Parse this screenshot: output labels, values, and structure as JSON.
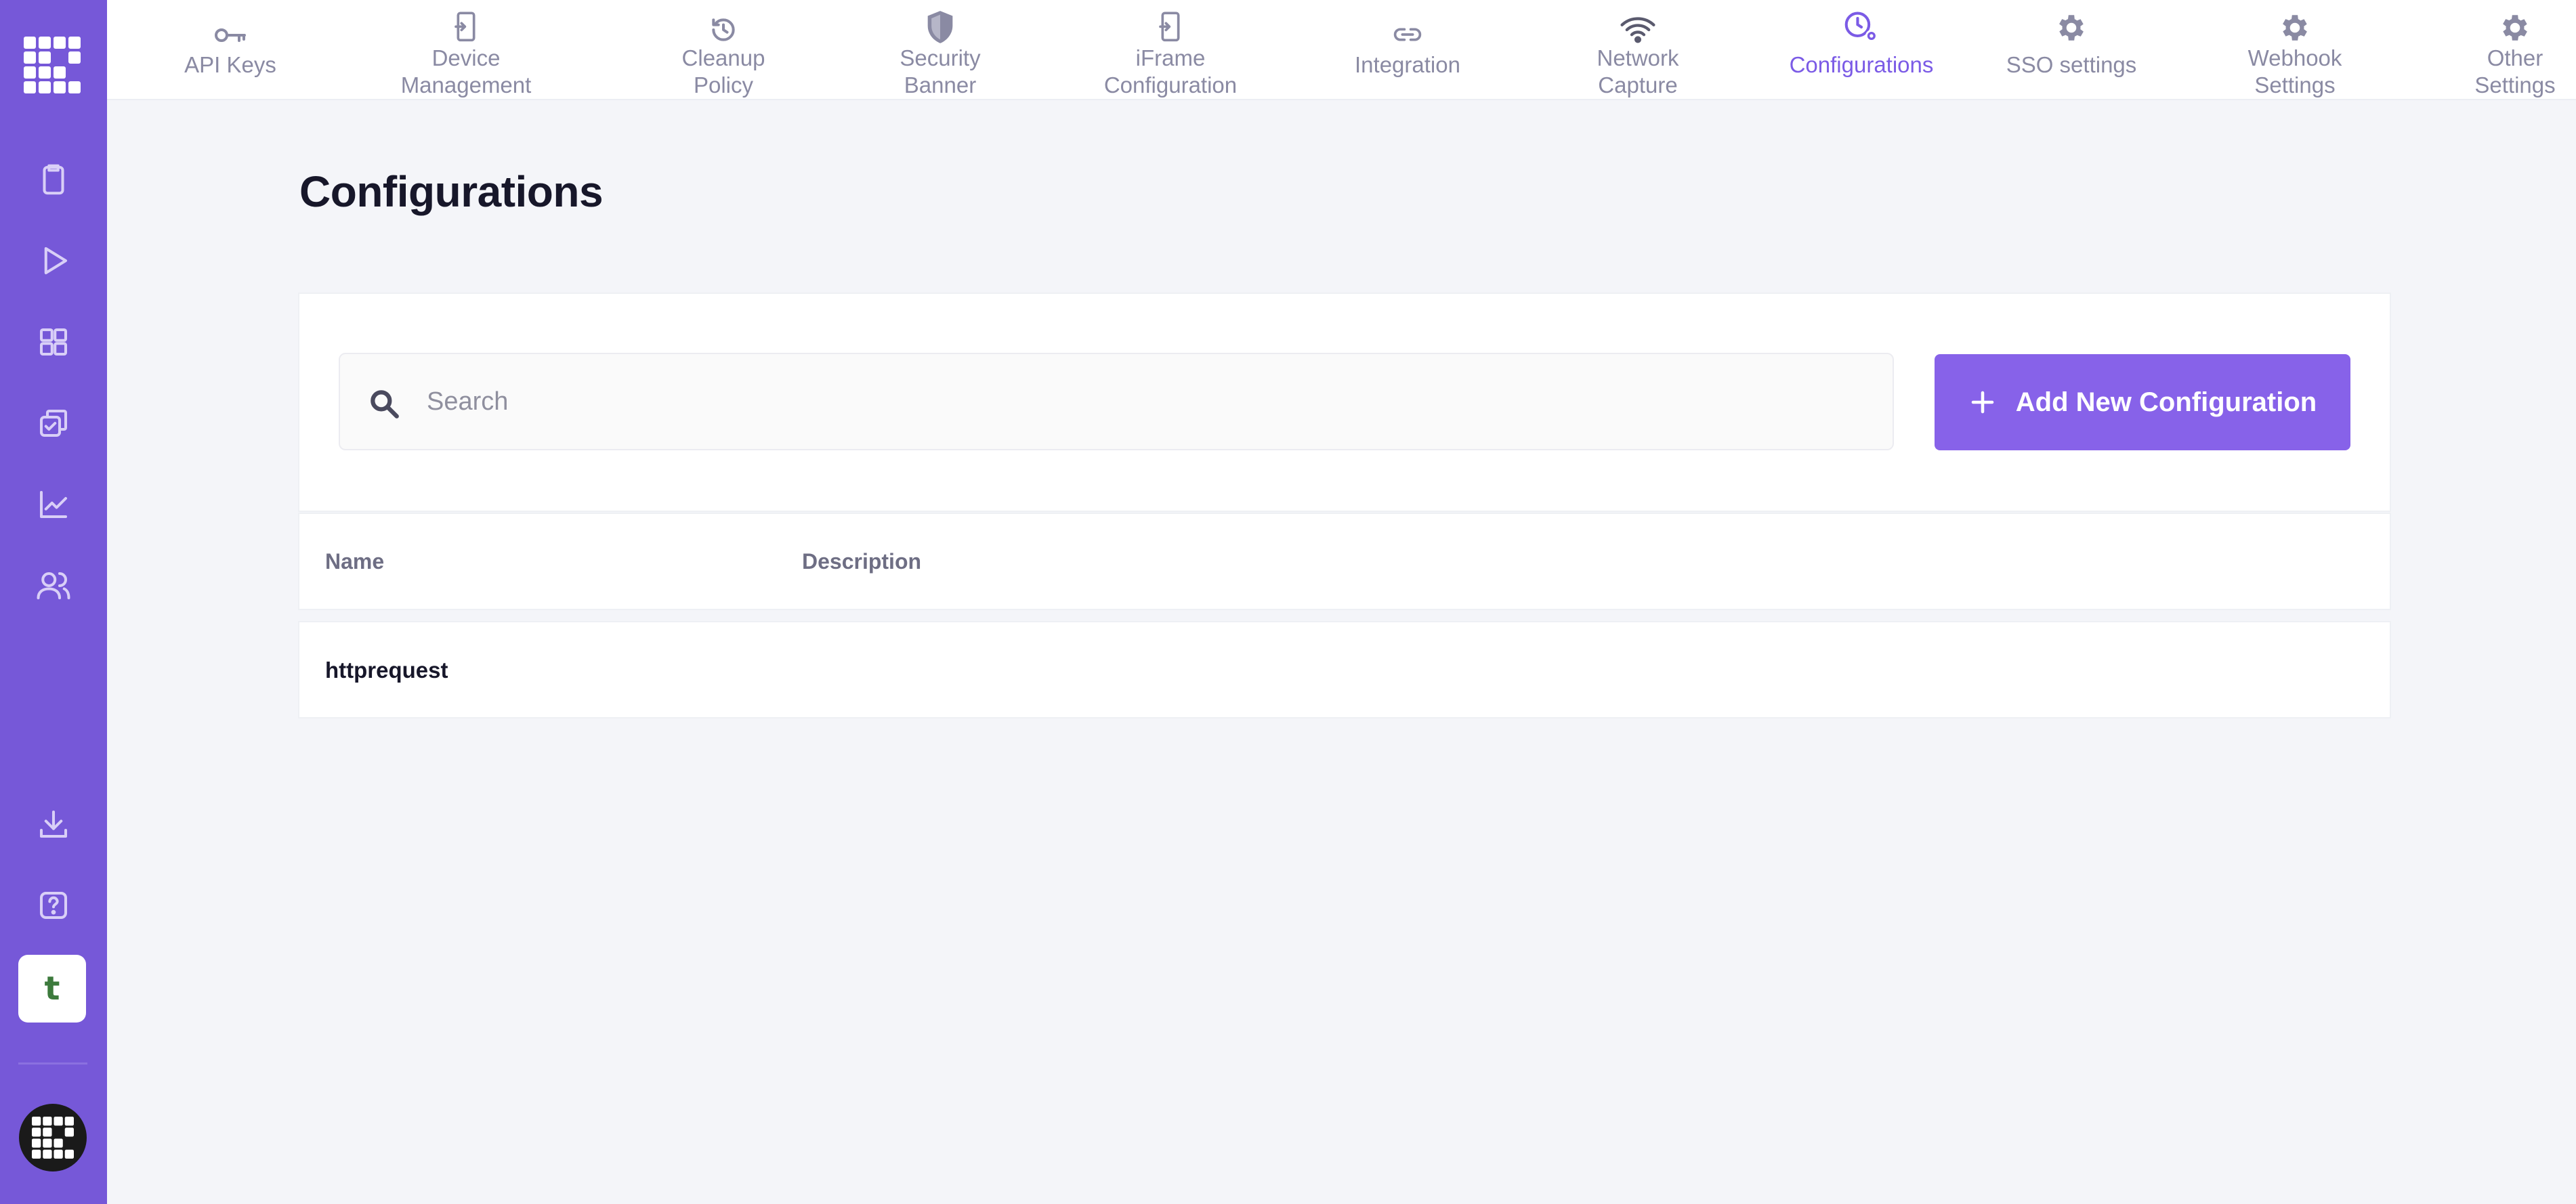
{
  "colors": {
    "sidebar": "#7658d8",
    "accent": "#7b5be6",
    "button": "#8762e9",
    "tab_inactive": "#8a8aa3",
    "background": "#f4f5f9"
  },
  "sidebar": {
    "items": [
      {
        "icon": "clipboard-icon"
      },
      {
        "icon": "play-icon"
      },
      {
        "icon": "grid-icon"
      },
      {
        "icon": "checklist-icon"
      },
      {
        "icon": "chart-icon"
      },
      {
        "icon": "users-icon"
      },
      {
        "icon": "download-icon"
      },
      {
        "icon": "help-icon"
      }
    ],
    "avatar_letter": "t"
  },
  "tabs": [
    {
      "label": "API Keys",
      "icon": "key-icon"
    },
    {
      "label": "Device\nManagement",
      "icon": "device-icon"
    },
    {
      "label": "Cleanup\nPolicy",
      "icon": "history-icon"
    },
    {
      "label": "Security\nBanner",
      "icon": "shield-icon"
    },
    {
      "label": "iFrame\nConfiguration",
      "icon": "iframe-icon"
    },
    {
      "label": "Integration",
      "icon": "link-icon"
    },
    {
      "label": "Network\nCapture",
      "icon": "wifi-icon"
    },
    {
      "label": "Configurations",
      "icon": "clock-gear-icon",
      "active": true
    },
    {
      "label": "SSO settings",
      "icon": "gear-icon"
    },
    {
      "label": "Webhook\nSettings",
      "icon": "gear-icon"
    },
    {
      "label": "Other\nSettings",
      "icon": "gear-icon"
    }
  ],
  "page": {
    "title": "Configurations"
  },
  "search": {
    "placeholder": "Search",
    "value": ""
  },
  "add_button": {
    "label": "Add New Configuration"
  },
  "table": {
    "columns": [
      "Name",
      "Description"
    ],
    "rows": [
      {
        "name": "httprequest",
        "description": ""
      }
    ]
  }
}
